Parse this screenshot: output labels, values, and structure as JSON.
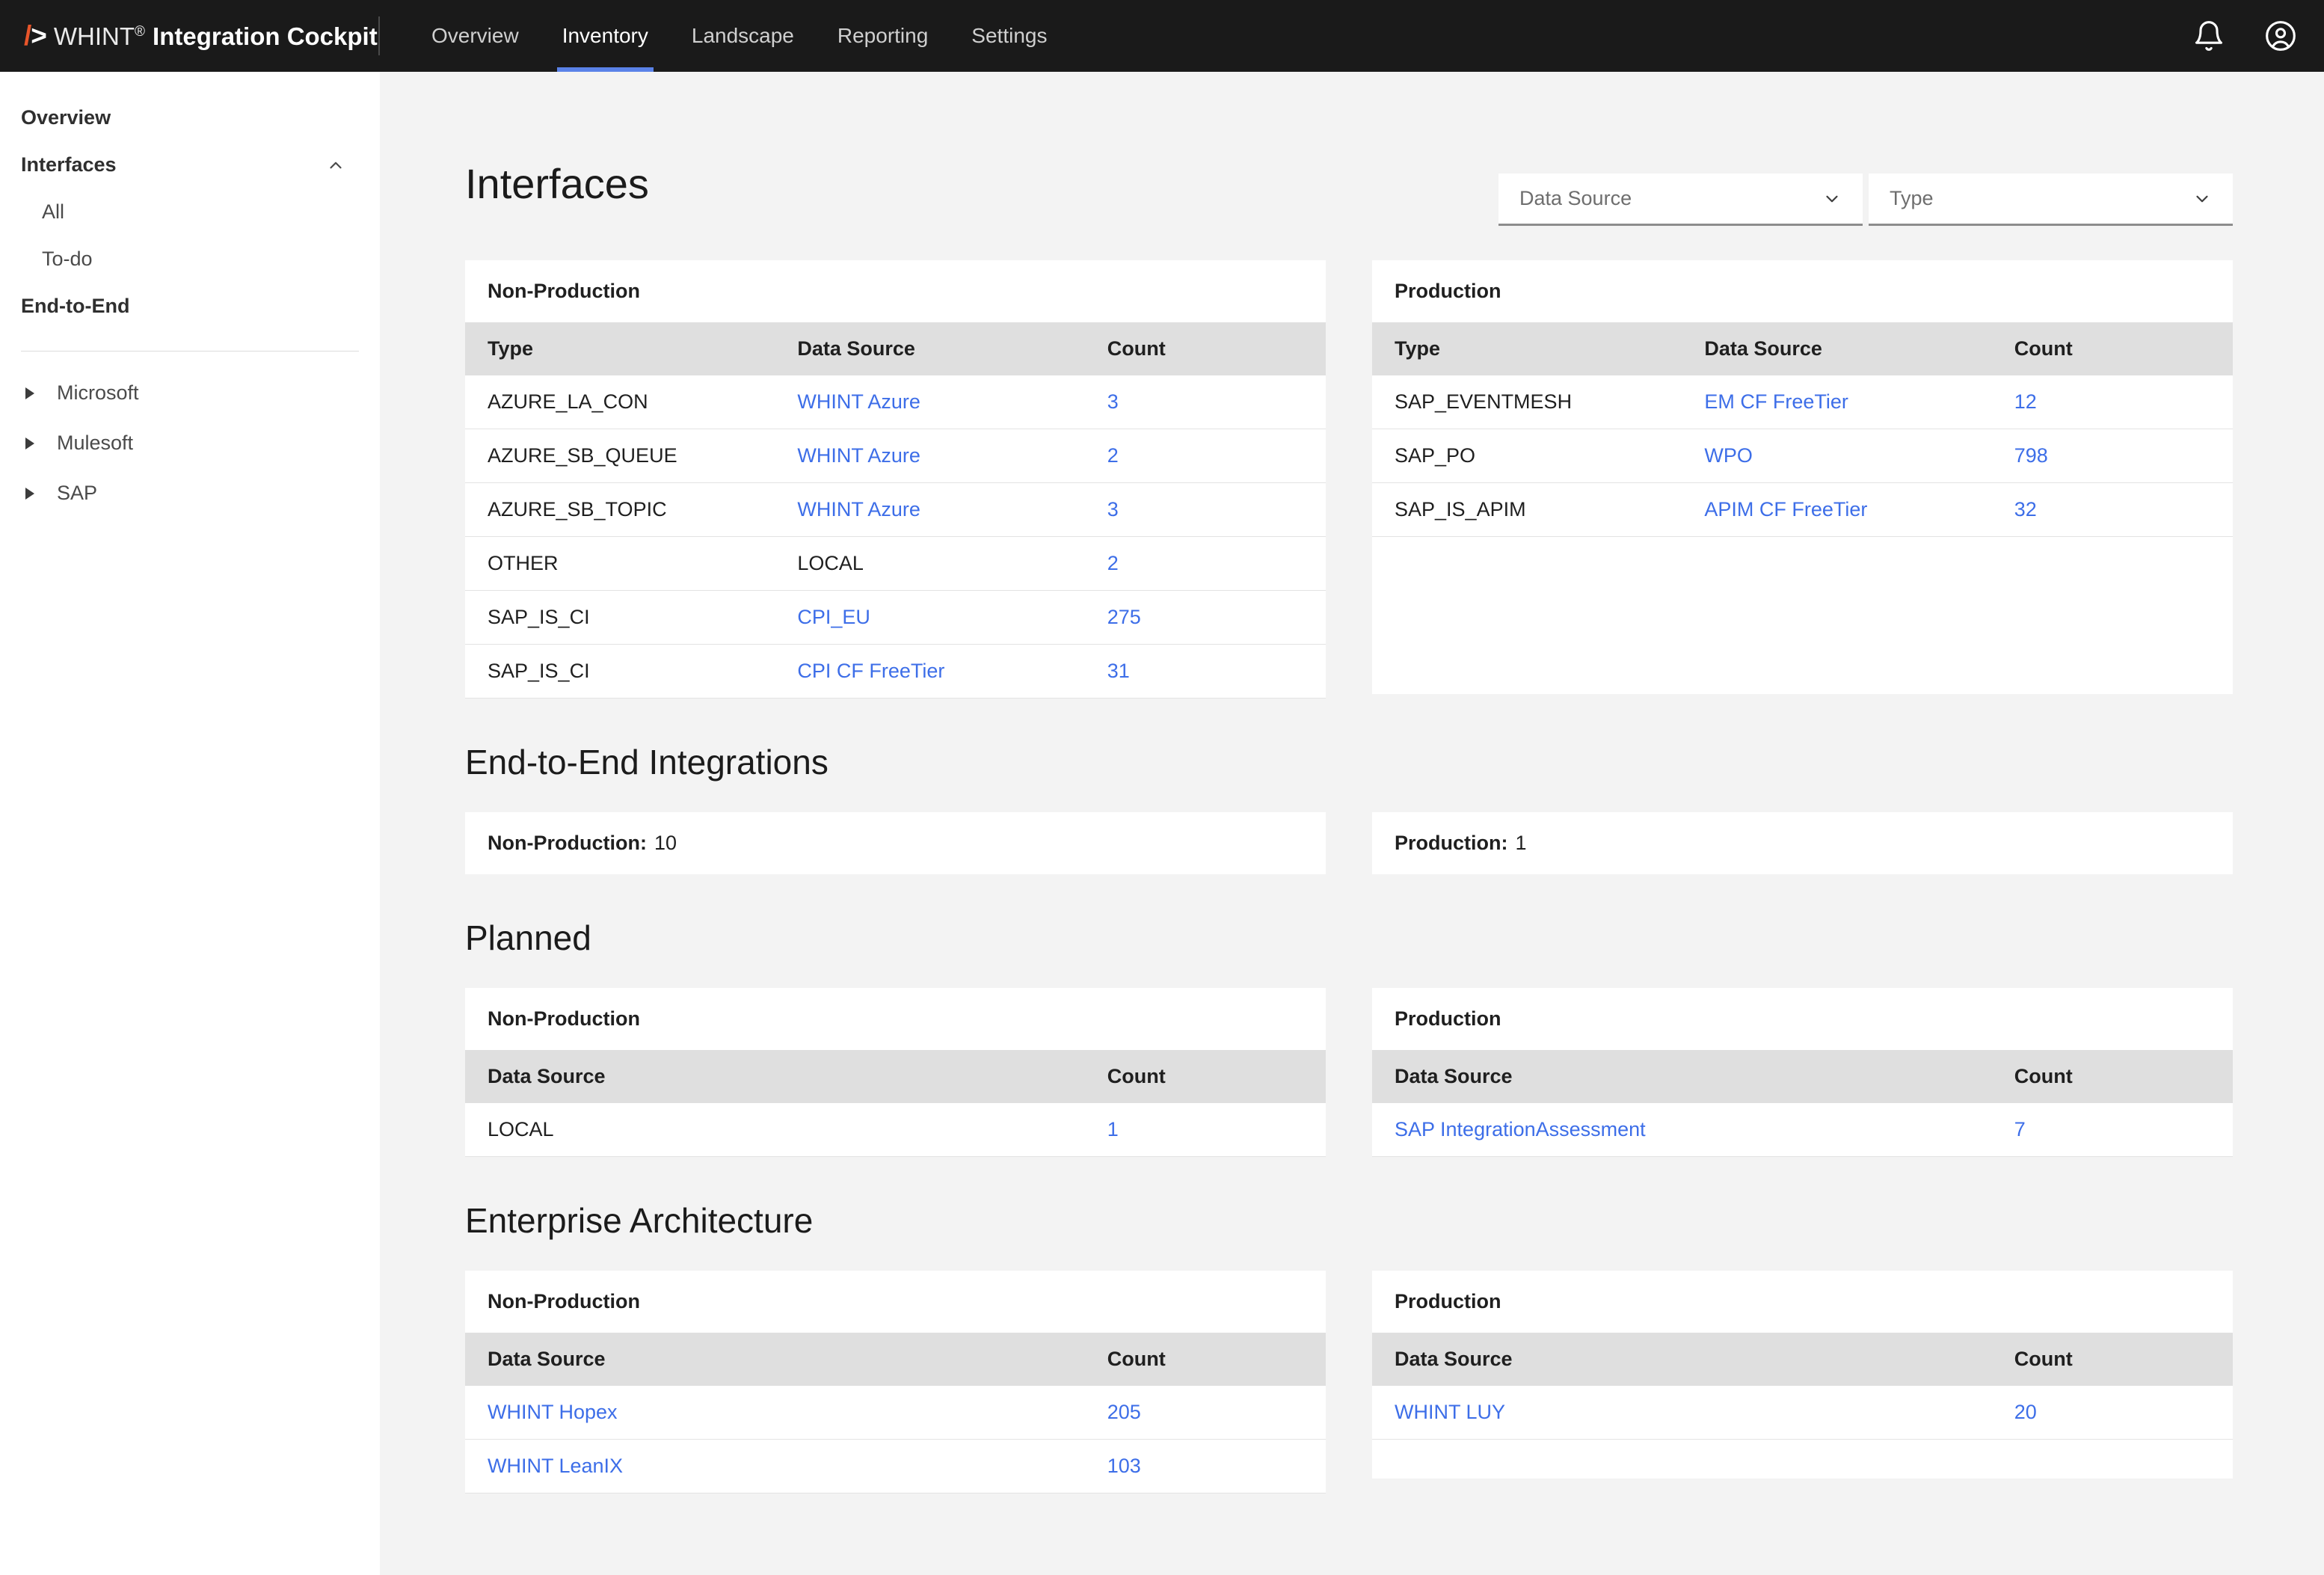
{
  "brand": {
    "mark_slash": "/",
    "mark_gt": ">",
    "name_light": "WHINT",
    "registered": "®",
    "name_bold": "Integration Cockpit"
  },
  "nav": {
    "tabs": [
      {
        "label": "Overview",
        "active": false
      },
      {
        "label": "Inventory",
        "active": true
      },
      {
        "label": "Landscape",
        "active": false
      },
      {
        "label": "Reporting",
        "active": false
      },
      {
        "label": "Settings",
        "active": false
      }
    ],
    "notifications_icon": "bell-icon",
    "account_icon": "account-circle-icon"
  },
  "sidebar": {
    "items": [
      {
        "label": "Overview",
        "style": "bold"
      },
      {
        "label": "Interfaces",
        "style": "bold",
        "chevron": "chevron-up-icon"
      },
      {
        "label": "All",
        "style": "child"
      },
      {
        "label": "To-do",
        "style": "child"
      },
      {
        "label": "End-to-End",
        "style": "bold"
      }
    ],
    "tree": [
      {
        "label": "Microsoft"
      },
      {
        "label": "Mulesoft"
      },
      {
        "label": "SAP"
      }
    ]
  },
  "filters": {
    "data_source": {
      "placeholder": "Data Source",
      "value": ""
    },
    "type": {
      "placeholder": "Type",
      "value": ""
    }
  },
  "sections": {
    "interfaces": {
      "title": "Interfaces",
      "nonprod": {
        "heading": "Non-Production",
        "columns": [
          "Type",
          "Data Source",
          "Count"
        ],
        "rows": [
          {
            "type": "AZURE_LA_CON",
            "source": "WHINT Azure",
            "source_link": true,
            "count": "3",
            "count_link": true
          },
          {
            "type": "AZURE_SB_QUEUE",
            "source": "WHINT Azure",
            "source_link": true,
            "count": "2",
            "count_link": true
          },
          {
            "type": "AZURE_SB_TOPIC",
            "source": "WHINT Azure",
            "source_link": true,
            "count": "3",
            "count_link": true
          },
          {
            "type": "OTHER",
            "source": "LOCAL",
            "source_link": false,
            "count": "2",
            "count_link": true
          },
          {
            "type": "SAP_IS_CI",
            "source": "CPI_EU",
            "source_link": true,
            "count": "275",
            "count_link": true
          },
          {
            "type": "SAP_IS_CI",
            "source": "CPI CF FreeTier",
            "source_link": true,
            "count": "31",
            "count_link": true
          }
        ]
      },
      "prod": {
        "heading": "Production",
        "columns": [
          "Type",
          "Data Source",
          "Count"
        ],
        "rows": [
          {
            "type": "SAP_EVENTMESH",
            "source": "EM CF FreeTier",
            "source_link": true,
            "count": "12",
            "count_link": true
          },
          {
            "type": "SAP_PO",
            "source": "WPO",
            "source_link": true,
            "count": "798",
            "count_link": true
          },
          {
            "type": "SAP_IS_APIM",
            "source": "APIM CF FreeTier",
            "source_link": true,
            "count": "32",
            "count_link": true
          }
        ]
      }
    },
    "e2e": {
      "title": "End-to-End Integrations",
      "nonprod": {
        "label": "Non-Production:",
        "value": "10"
      },
      "prod": {
        "label": "Production:",
        "value": "1"
      }
    },
    "planned": {
      "title": "Planned",
      "nonprod": {
        "heading": "Non-Production",
        "columns": [
          "Data Source",
          "Count"
        ],
        "rows": [
          {
            "source": "LOCAL",
            "source_link": false,
            "count": "1",
            "count_link": true
          }
        ]
      },
      "prod": {
        "heading": "Production",
        "columns": [
          "Data Source",
          "Count"
        ],
        "rows": [
          {
            "source": "SAP IntegrationAssessment",
            "source_link": true,
            "count": "7",
            "count_link": true
          }
        ]
      }
    },
    "ea": {
      "title": "Enterprise Architecture",
      "nonprod": {
        "heading": "Non-Production",
        "columns": [
          "Data Source",
          "Count"
        ],
        "rows": [
          {
            "source": "WHINT Hopex",
            "source_link": true,
            "count": "205",
            "count_link": true
          },
          {
            "source": "WHINT LeanIX",
            "source_link": true,
            "count": "103",
            "count_link": true
          }
        ]
      },
      "prod": {
        "heading": "Production",
        "columns": [
          "Data Source",
          "Count"
        ],
        "rows": [
          {
            "source": "WHINT LUY",
            "source_link": true,
            "count": "20",
            "count_link": true
          }
        ]
      }
    }
  },
  "colors": {
    "topbar_bg": "#1a1a1a",
    "accent_orange": "#e8552a",
    "active_tab_underline": "#5a82e8",
    "link_blue": "#3d6ee8",
    "page_bg": "#f3f3f3",
    "table_header_bg": "#dfdfdf",
    "card_bg": "#ffffff"
  }
}
